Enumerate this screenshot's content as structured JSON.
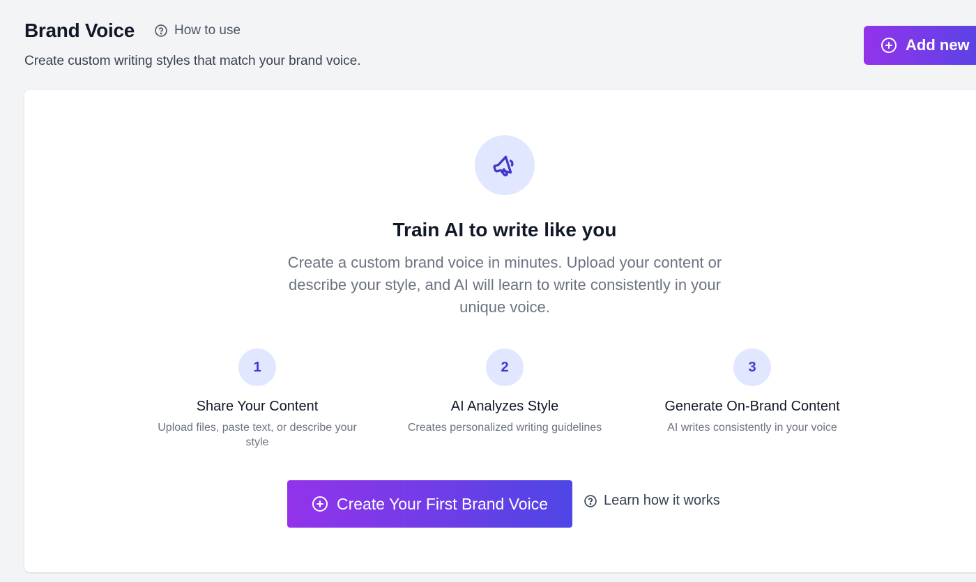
{
  "header": {
    "title": "Brand Voice",
    "how_to_use_label": "How to use",
    "subtitle": "Create custom writing styles that match your brand voice.",
    "add_new_label": "Add new"
  },
  "hero": {
    "icon": "megaphone-icon",
    "title": "Train AI to write like you",
    "description": "Create a custom brand voice in minutes. Upload your content or describe your style, and AI will learn to write consistently in your unique voice."
  },
  "steps": [
    {
      "number": "1",
      "title": "Share Your Content",
      "description": "Upload files, paste text, or describe your style"
    },
    {
      "number": "2",
      "title": "AI Analyzes Style",
      "description": "Creates personalized writing guidelines"
    },
    {
      "number": "3",
      "title": "Generate On-Brand Content",
      "description": "AI writes consistently in your voice"
    }
  ],
  "actions": {
    "create_label": "Create Your First Brand Voice",
    "learn_label": "Learn how it works"
  },
  "colors": {
    "accent_gradient_start": "#9333ea",
    "accent_gradient_end": "#4f46e5",
    "icon_bg": "#e0e7ff",
    "icon_fg": "#4338ca"
  }
}
